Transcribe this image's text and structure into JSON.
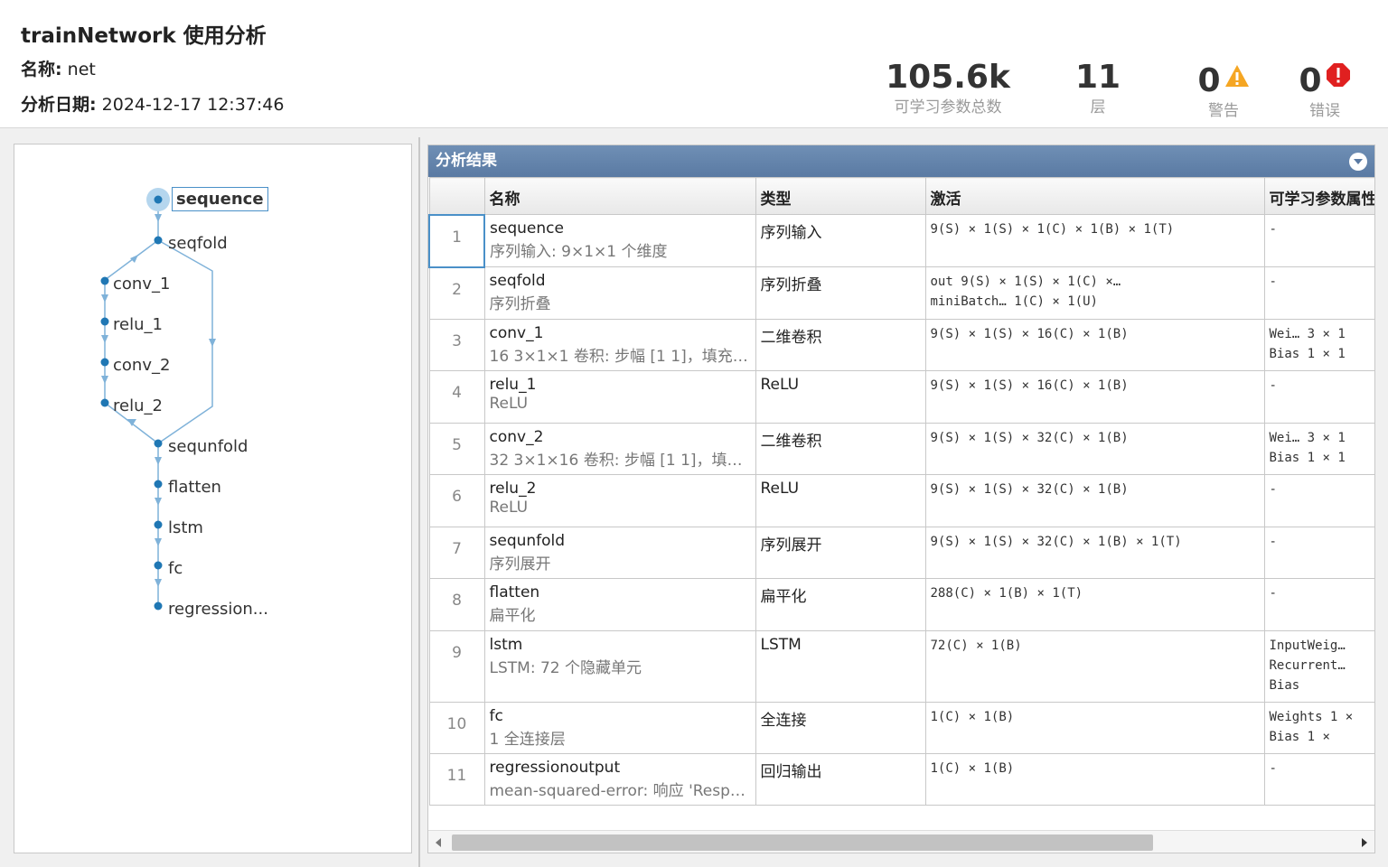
{
  "header": {
    "title": "trainNetwork 使用分析",
    "name_label": "名称:",
    "name_value": "net",
    "date_label": "分析日期:",
    "date_value": "2024-12-17 12:37:46",
    "stats": {
      "params_value": "105.6k",
      "params_label": "可学习参数总数",
      "layers_value": "11",
      "layers_label": "层",
      "warnings_value": "0",
      "warnings_label": "警告",
      "errors_value": "0",
      "errors_label": "错误"
    },
    "colors": {
      "warning": "#f5a623",
      "error": "#e02020"
    }
  },
  "graph": {
    "nodes": [
      "sequence",
      "seqfold",
      "conv_1",
      "relu_1",
      "conv_2",
      "relu_2",
      "sequnfold",
      "flatten",
      "lstm",
      "fc",
      "regression..."
    ],
    "selected": "sequence",
    "accent": "#1f77b4"
  },
  "results": {
    "title": "分析结果",
    "columns": [
      "",
      "名称",
      "类型",
      "激活",
      "可学习参数属性"
    ],
    "rows": [
      {
        "idx": "1",
        "name": "sequence",
        "desc": "序列输入: 9×1×1 个维度",
        "type": "序列输入",
        "act1": "9(S) × 1(S) × 1(C) × 1(B) × 1(T)",
        "act2": "",
        "learn1": "-",
        "learn2": ""
      },
      {
        "idx": "2",
        "name": "seqfold",
        "desc": "序列折叠",
        "type": "序列折叠",
        "act1": "out         9(S) × 1(S) × 1(C) ×…",
        "act2": "miniBatch…  1(C) × 1(U)",
        "learn1": "-",
        "learn2": ""
      },
      {
        "idx": "3",
        "name": "conv_1",
        "desc": "16 3×1×1 卷积: 步幅 [1 1]，填充 's...",
        "type": "二维卷积",
        "act1": "9(S) × 1(S) × 16(C) × 1(B)",
        "act2": "",
        "learn1": "Wei…  3 × 1",
        "learn2": "Bias  1 × 1"
      },
      {
        "idx": "4",
        "name": "relu_1",
        "desc": "ReLU",
        "type": "ReLU",
        "act1": "9(S) × 1(S) × 16(C) × 1(B)",
        "act2": "",
        "learn1": "-",
        "learn2": ""
      },
      {
        "idx": "5",
        "name": "conv_2",
        "desc": "32 3×1×16 卷积: 步幅 [1 1]，填充 ...",
        "type": "二维卷积",
        "act1": "9(S) × 1(S) × 32(C) × 1(B)",
        "act2": "",
        "learn1": "Wei…  3 × 1",
        "learn2": "Bias  1 × 1"
      },
      {
        "idx": "6",
        "name": "relu_2",
        "desc": "ReLU",
        "type": "ReLU",
        "act1": "9(S) × 1(S) × 32(C) × 1(B)",
        "act2": "",
        "learn1": "-",
        "learn2": ""
      },
      {
        "idx": "7",
        "name": "sequnfold",
        "desc": "序列展开",
        "type": "序列展开",
        "act1": "9(S) × 1(S) × 32(C) × 1(B) × 1(T)",
        "act2": "",
        "learn1": "-",
        "learn2": ""
      },
      {
        "idx": "8",
        "name": "flatten",
        "desc": "扁平化",
        "type": "扁平化",
        "act1": "288(C) × 1(B) × 1(T)",
        "act2": "",
        "learn1": "-",
        "learn2": ""
      },
      {
        "idx": "9",
        "name": "lstm",
        "desc": "LSTM: 72 个隐藏单元",
        "type": "LSTM",
        "act1": "72(C) × 1(B)",
        "act2": "",
        "learn1": "InputWeig…",
        "learn2": "Recurrent…",
        "learn3": "Bias"
      },
      {
        "idx": "10",
        "name": "fc",
        "desc": "1 全连接层",
        "type": "全连接",
        "act1": "1(C) × 1(B)",
        "act2": "",
        "learn1": "Weights  1 ×",
        "learn2": "Bias     1 ×"
      },
      {
        "idx": "11",
        "name": "regressionoutput",
        "desc": "mean-squared-error: 响应 'Respon...",
        "type": "回归输出",
        "act1": "1(C) × 1(B)",
        "act2": "",
        "learn1": "-",
        "learn2": ""
      }
    ]
  }
}
